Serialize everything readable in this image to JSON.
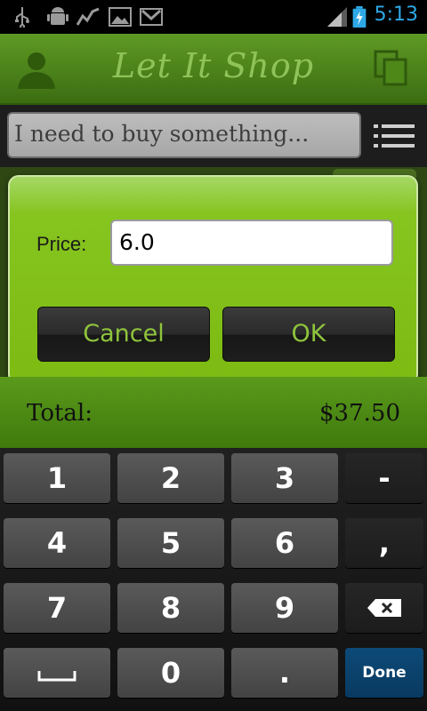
{
  "status_bar": {
    "icons": [
      "usb-icon",
      "android-debug-icon",
      "activity-chart-icon",
      "gallery-icon",
      "gmail-icon",
      "signal-icon",
      "battery-charging-icon"
    ],
    "time": "5:13"
  },
  "app_bar": {
    "title": "Let It Shop",
    "left_icon": "person-icon",
    "right_icon": "copy-icon"
  },
  "search": {
    "placeholder": "I need to buy something...",
    "list_icon": "list-icon"
  },
  "dialog": {
    "price_label": "Price:",
    "price_value": "6.0",
    "cancel_label": "Cancel",
    "ok_label": "OK"
  },
  "total": {
    "label": "Total:",
    "value": "$37.50"
  },
  "keyboard": {
    "rows": [
      [
        "1",
        "2",
        "3",
        "-"
      ],
      [
        "4",
        "5",
        "6",
        ","
      ],
      [
        "7",
        "8",
        "9",
        "⌫"
      ],
      [
        "␣",
        "0",
        ".",
        "Done"
      ]
    ]
  },
  "colors": {
    "accent_green": "#7dbb13",
    "clock_blue": "#2ea8e6",
    "done_key_blue": "#0d4a78"
  }
}
